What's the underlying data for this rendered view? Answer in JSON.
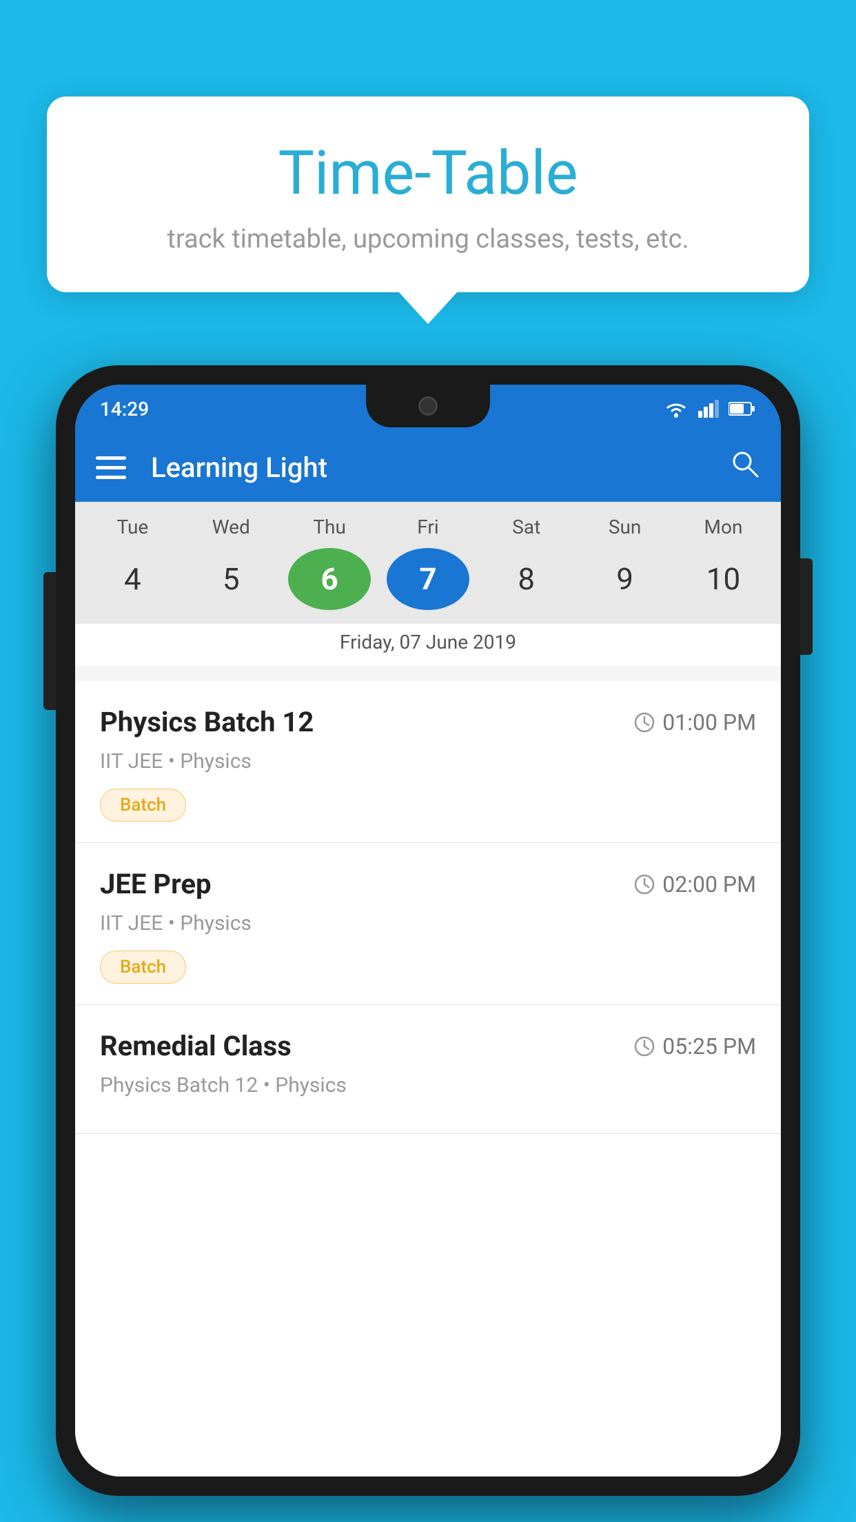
{
  "background_color": "#1BB8E8",
  "tooltip": {
    "title": "Time-Table",
    "subtitle": "track timetable, upcoming classes, tests, etc."
  },
  "phone": {
    "status_bar": {
      "time": "14:29"
    },
    "app_bar": {
      "title": "Learning Light"
    },
    "calendar": {
      "days": [
        "Tue",
        "Wed",
        "Thu",
        "Fri",
        "Sat",
        "Sun",
        "Mon"
      ],
      "dates": [
        "4",
        "5",
        "6",
        "7",
        "8",
        "9",
        "10"
      ],
      "today_index": 2,
      "selected_index": 3,
      "selected_label": "Friday, 07 June 2019"
    },
    "classes": [
      {
        "name": "Physics Batch 12",
        "time": "01:00 PM",
        "meta": "IIT JEE • Physics",
        "badge": "Batch"
      },
      {
        "name": "JEE Prep",
        "time": "02:00 PM",
        "meta": "IIT JEE • Physics",
        "badge": "Batch"
      },
      {
        "name": "Remedial Class",
        "time": "05:25 PM",
        "meta": "Physics Batch 12 • Physics",
        "badge": ""
      }
    ]
  },
  "icons": {
    "hamburger": "menu",
    "search": "🔍",
    "clock": "🕐"
  }
}
